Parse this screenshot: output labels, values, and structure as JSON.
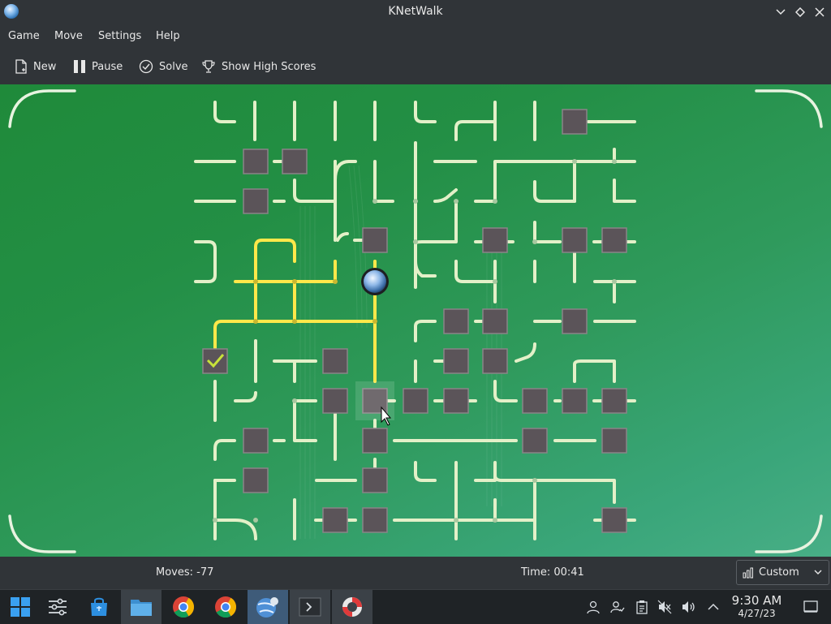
{
  "window": {
    "title": "KNetWalk",
    "app_icon": "knetwalk-globe-icon"
  },
  "menu": {
    "items": [
      "Game",
      "Move",
      "Settings",
      "Help"
    ]
  },
  "toolbar": {
    "new_label": "New",
    "pause_label": "Pause",
    "solve_label": "Solve",
    "highscores_label": "Show High Scores"
  },
  "status": {
    "moves": "Moves: -77",
    "time": "Time: 00:41",
    "difficulty": "Custom"
  },
  "taskbar": {
    "time": "9:30 AM",
    "date": "4/27/23"
  },
  "colors": {
    "board_green": "#2a9450",
    "pipe": "#e3f0c8",
    "pipe_powered": "#ffe84a",
    "terminal": "#5b5459"
  }
}
